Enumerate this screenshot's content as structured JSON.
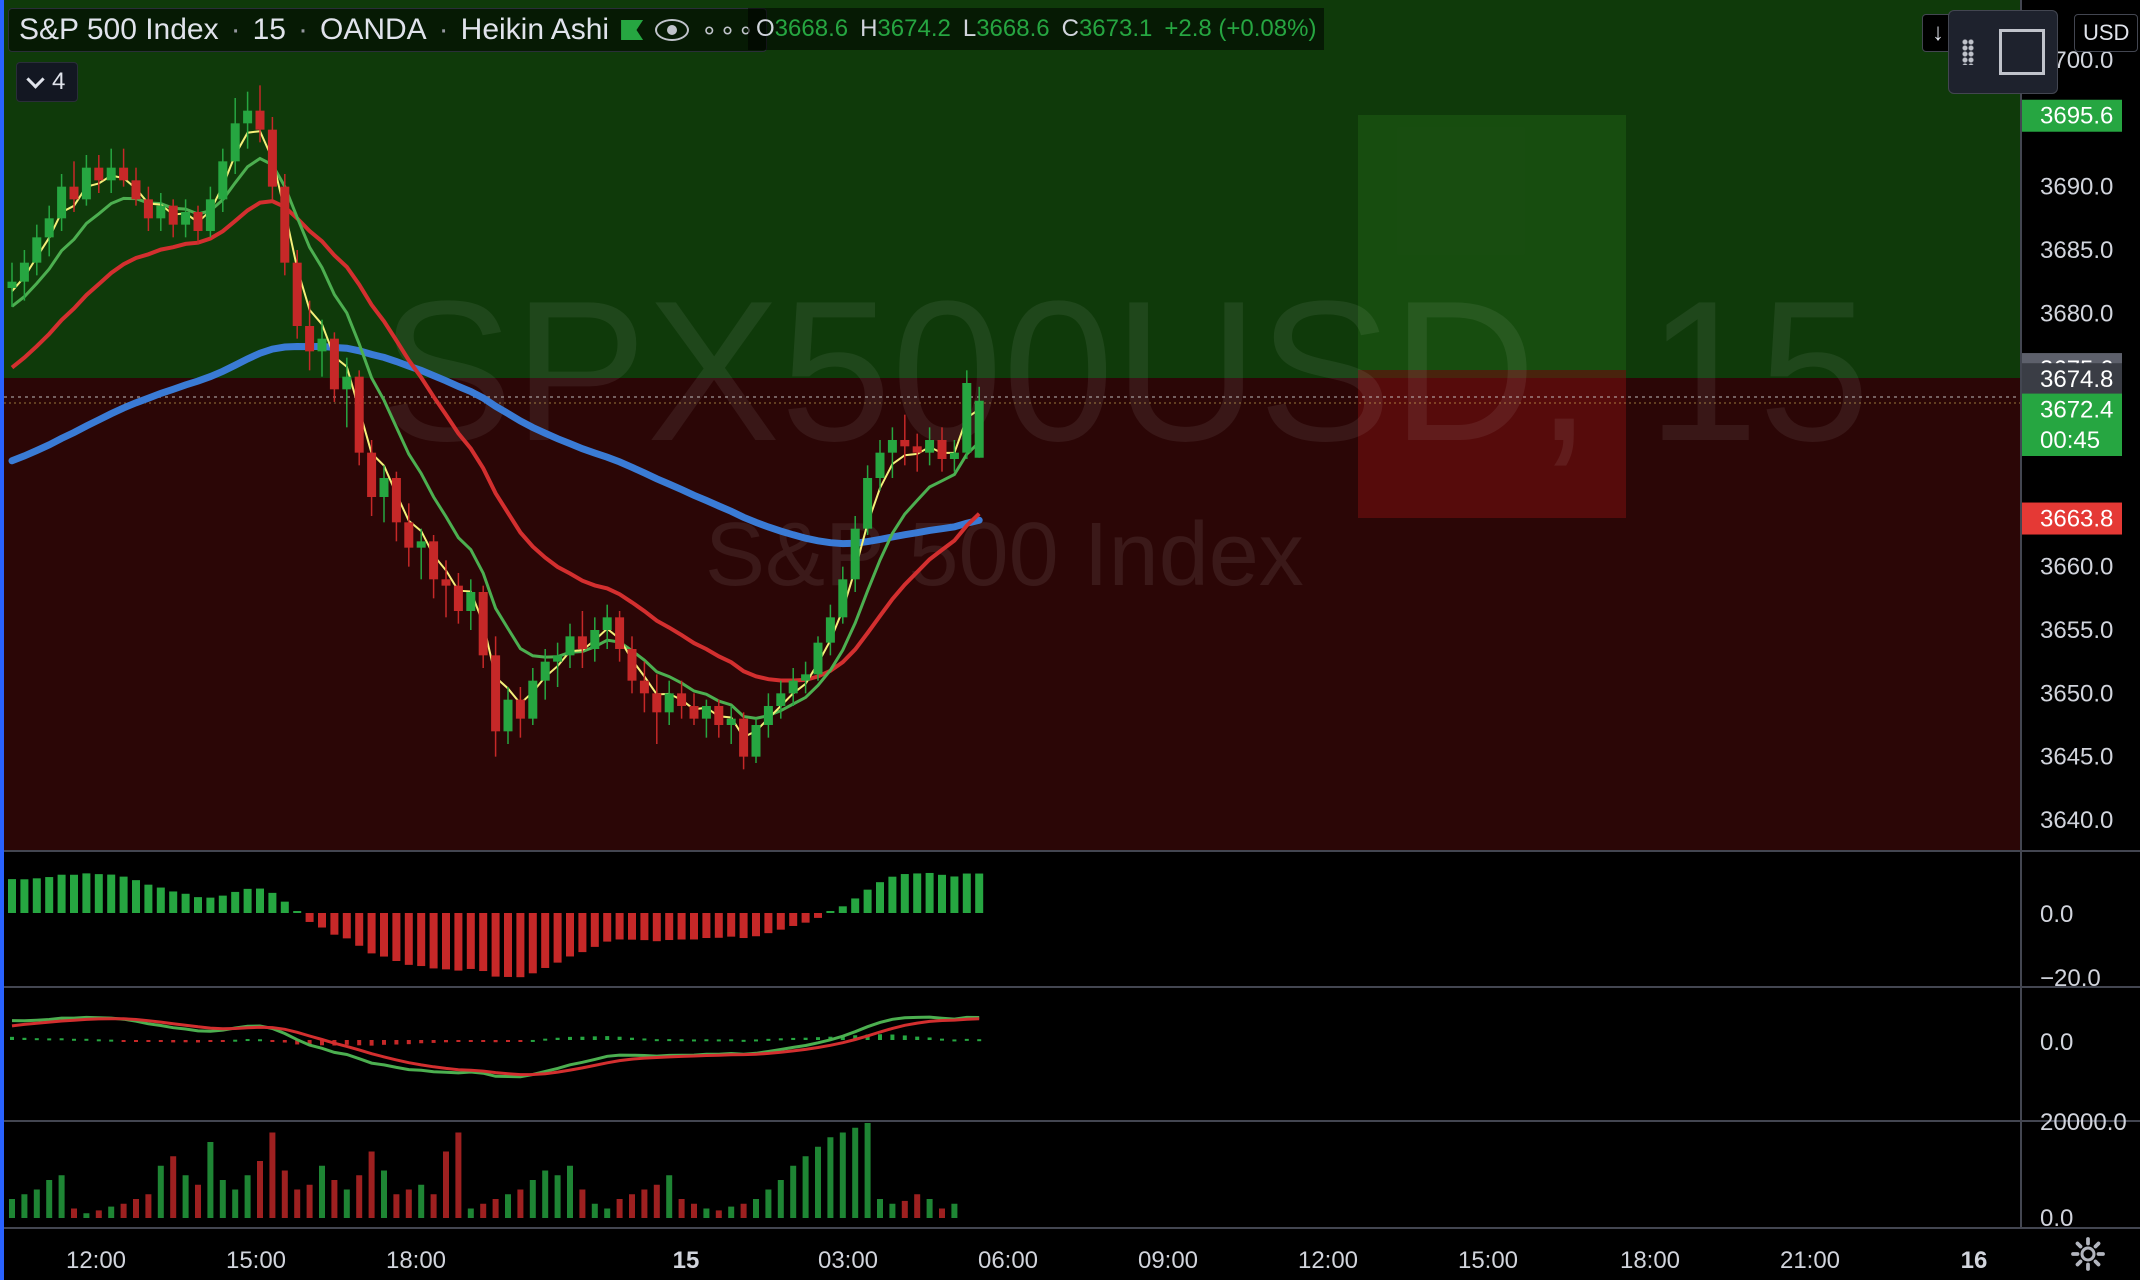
{
  "header": {
    "symbol_name": "S&P 500 Index",
    "interval": "15",
    "broker": "OANDA",
    "chart_style": "Heikin Ashi",
    "ohlc": {
      "o_label": "O",
      "o": "3668.6",
      "h_label": "H",
      "h": "3674.2",
      "l_label": "L",
      "l": "3668.6",
      "c_label": "C",
      "c": "3673.1",
      "change": "+2.8 (+0.08%)"
    },
    "indicators_collapsed_count": "4",
    "currency": "USD",
    "icons": [
      "flag-icon",
      "eye-icon",
      "more-icon",
      "chevron-down-icon",
      "arrow-down-icon",
      "drag-grip-icon",
      "select-box-icon",
      "gear-icon"
    ]
  },
  "watermark": {
    "big": "SPX500USD, 15",
    "small": "S&P 500 Index"
  },
  "price_axis": {
    "ticks": [
      "3700.0",
      "3690.0",
      "3685.0",
      "3680.0",
      "3660.0",
      "3655.0",
      "3650.0",
      "3645.0",
      "3640.0"
    ],
    "tick_values": [
      3700,
      3690,
      3685,
      3680,
      3660,
      3655,
      3650,
      3645,
      3640
    ],
    "labels": [
      {
        "text": "3695.6",
        "value": 3695.6,
        "bg": "#26a641",
        "fg": "#ffffff"
      },
      {
        "text": "3675.6",
        "value": 3675.6,
        "bg": "#5d606b",
        "fg": "#ffffff"
      },
      {
        "text": "3674.8",
        "value": 3674.8,
        "bg": "#3a3d45",
        "fg": "#ffffff"
      },
      {
        "text": "3672.4",
        "value": 3672.4,
        "bg": "#26a641",
        "fg": "#ffffff"
      },
      {
        "text": "00:45",
        "value": 3670.0,
        "bg": "#26a641",
        "fg": "#ffffff"
      },
      {
        "text": "3663.8",
        "value": 3663.8,
        "bg": "#e53935",
        "fg": "#ffffff"
      }
    ]
  },
  "pane_axes": {
    "momentum": {
      "ticks": [
        "0.0",
        "−20.0"
      ]
    },
    "macd": {
      "ticks": [
        "0.0"
      ]
    },
    "volume": {
      "ticks": [
        "20000.0",
        "0.0"
      ]
    }
  },
  "time_axis": {
    "labels": [
      "12:00",
      "15:00",
      "18:00",
      "15",
      "03:00",
      "06:00",
      "09:00",
      "12:00",
      "15:00",
      "18:00",
      "21:00",
      "16"
    ],
    "bold": [
      "15",
      "16"
    ]
  },
  "colors": {
    "up": "#26a641",
    "down": "#c62828",
    "ema_fast": "#f5f07a",
    "ema_mid": "#4caf50",
    "ema_slow": "#d32f2f",
    "ma_long": "#3a7bd5",
    "zone_profit": "#0f3a0a",
    "zone_loss": "#2b0606"
  },
  "chart_data": {
    "type": "candlestick",
    "ylim": [
      3638,
      3704
    ],
    "candle_step_minutes": 15,
    "candles_ohlc": [
      [
        3682.0,
        3684.0,
        3680.5,
        3682.5
      ],
      [
        3682.5,
        3685.0,
        3681.0,
        3684.0
      ],
      [
        3684.0,
        3687.0,
        3683.0,
        3686.0
      ],
      [
        3686.0,
        3688.5,
        3684.5,
        3687.5
      ],
      [
        3687.5,
        3691.0,
        3686.5,
        3690.0
      ],
      [
        3690.0,
        3692.0,
        3688.0,
        3689.0
      ],
      [
        3689.0,
        3692.5,
        3688.5,
        3691.5
      ],
      [
        3691.5,
        3692.5,
        3689.5,
        3690.5
      ],
      [
        3690.5,
        3693.0,
        3689.5,
        3691.5
      ],
      [
        3691.5,
        3693.0,
        3690.0,
        3690.5
      ],
      [
        3690.5,
        3691.5,
        3688.5,
        3689.0
      ],
      [
        3689.0,
        3690.0,
        3686.5,
        3687.5
      ],
      [
        3687.5,
        3689.5,
        3686.5,
        3688.5
      ],
      [
        3688.5,
        3689.0,
        3686.0,
        3687.0
      ],
      [
        3687.0,
        3689.0,
        3686.0,
        3688.0
      ],
      [
        3688.0,
        3688.5,
        3685.5,
        3686.5
      ],
      [
        3686.5,
        3690.0,
        3686.0,
        3689.0
      ],
      [
        3689.0,
        3693.0,
        3688.0,
        3692.0
      ],
      [
        3692.0,
        3697.0,
        3691.0,
        3695.0
      ],
      [
        3695.0,
        3697.5,
        3693.0,
        3696.0
      ],
      [
        3696.0,
        3698.0,
        3693.5,
        3694.5
      ],
      [
        3694.5,
        3695.5,
        3689.0,
        3690.0
      ],
      [
        3690.0,
        3691.0,
        3683.0,
        3684.0
      ],
      [
        3684.0,
        3685.0,
        3678.0,
        3679.0
      ],
      [
        3679.0,
        3681.0,
        3675.5,
        3677.0
      ],
      [
        3677.0,
        3679.5,
        3675.0,
        3678.0
      ],
      [
        3678.0,
        3678.5,
        3673.0,
        3674.0
      ],
      [
        3674.0,
        3676.5,
        3671.0,
        3675.0
      ],
      [
        3675.0,
        3675.5,
        3668.0,
        3669.0
      ],
      [
        3669.0,
        3670.0,
        3664.0,
        3665.5
      ],
      [
        3665.5,
        3668.0,
        3663.5,
        3667.0
      ],
      [
        3667.0,
        3667.5,
        3662.0,
        3663.5
      ],
      [
        3663.5,
        3665.0,
        3660.0,
        3661.5
      ],
      [
        3661.5,
        3663.0,
        3659.0,
        3662.0
      ],
      [
        3662.0,
        3662.5,
        3657.5,
        3659.0
      ],
      [
        3659.0,
        3660.5,
        3656.0,
        3658.5
      ],
      [
        3658.5,
        3659.5,
        3655.5,
        3656.5
      ],
      [
        3656.5,
        3659.0,
        3655.0,
        3658.0
      ],
      [
        3658.0,
        3658.5,
        3652.0,
        3653.0
      ],
      [
        3653.0,
        3654.5,
        3645.0,
        3647.0
      ],
      [
        3647.0,
        3650.5,
        3646.0,
        3649.5
      ],
      [
        3649.5,
        3650.5,
        3646.5,
        3648.0
      ],
      [
        3648.0,
        3652.0,
        3647.5,
        3651.0
      ],
      [
        3651.0,
        3653.5,
        3649.5,
        3652.5
      ],
      [
        3652.5,
        3654.0,
        3650.5,
        3653.0
      ],
      [
        3653.0,
        3655.5,
        3652.0,
        3654.5
      ],
      [
        3654.5,
        3656.5,
        3652.0,
        3653.5
      ],
      [
        3653.5,
        3656.0,
        3652.5,
        3655.0
      ],
      [
        3655.0,
        3657.0,
        3653.5,
        3656.0
      ],
      [
        3656.0,
        3656.5,
        3652.5,
        3653.5
      ],
      [
        3653.5,
        3654.5,
        3650.0,
        3651.0
      ],
      [
        3651.0,
        3652.5,
        3648.5,
        3650.0
      ],
      [
        3650.0,
        3651.5,
        3646.0,
        3648.5
      ],
      [
        3648.5,
        3651.0,
        3647.5,
        3650.0
      ],
      [
        3650.0,
        3651.0,
        3648.0,
        3649.0
      ],
      [
        3649.0,
        3650.0,
        3647.5,
        3648.0
      ],
      [
        3648.0,
        3649.5,
        3646.5,
        3649.0
      ],
      [
        3649.0,
        3649.5,
        3646.5,
        3647.5
      ],
      [
        3647.5,
        3649.0,
        3646.0,
        3648.0
      ],
      [
        3648.0,
        3648.5,
        3644.0,
        3645.0
      ],
      [
        3645.0,
        3648.0,
        3644.5,
        3647.5
      ],
      [
        3647.5,
        3650.0,
        3646.5,
        3649.0
      ],
      [
        3649.0,
        3651.0,
        3648.0,
        3650.0
      ],
      [
        3650.0,
        3652.0,
        3649.0,
        3651.0
      ],
      [
        3651.0,
        3652.5,
        3650.0,
        3651.5
      ],
      [
        3651.5,
        3654.5,
        3651.0,
        3654.0
      ],
      [
        3654.0,
        3657.0,
        3653.0,
        3656.0
      ],
      [
        3656.0,
        3660.0,
        3655.5,
        3659.0
      ],
      [
        3659.0,
        3664.0,
        3658.0,
        3663.0
      ],
      [
        3663.0,
        3668.0,
        3662.5,
        3667.0
      ],
      [
        3667.0,
        3670.0,
        3666.0,
        3669.0
      ],
      [
        3669.0,
        3671.0,
        3667.0,
        3670.0
      ],
      [
        3670.0,
        3672.0,
        3668.0,
        3669.5
      ],
      [
        3669.5,
        3670.5,
        3667.5,
        3669.0
      ],
      [
        3669.0,
        3671.0,
        3668.0,
        3670.0
      ],
      [
        3670.0,
        3671.0,
        3667.5,
        3668.5
      ],
      [
        3668.5,
        3670.0,
        3667.5,
        3669.0
      ],
      [
        3669.0,
        3675.5,
        3668.5,
        3674.5
      ],
      [
        3668.6,
        3674.2,
        3668.6,
        3673.1
      ]
    ],
    "volume_hist": [
      20,
      25,
      30,
      40,
      45,
      10,
      5,
      8,
      12,
      15,
      20,
      25,
      55,
      65,
      45,
      35,
      80,
      40,
      30,
      45,
      60,
      90,
      50,
      30,
      35,
      55,
      40,
      30,
      45,
      70,
      50,
      25,
      30,
      35,
      25,
      70,
      90,
      10,
      15,
      20,
      25,
      30,
      40,
      50,
      45,
      55,
      30,
      15,
      10,
      20,
      25,
      30,
      35,
      45,
      20,
      15,
      10,
      8,
      12,
      15,
      20,
      30,
      40,
      55,
      65,
      75,
      85,
      90,
      95,
      100,
      20,
      15,
      18,
      25,
      20,
      10,
      15
    ]
  }
}
